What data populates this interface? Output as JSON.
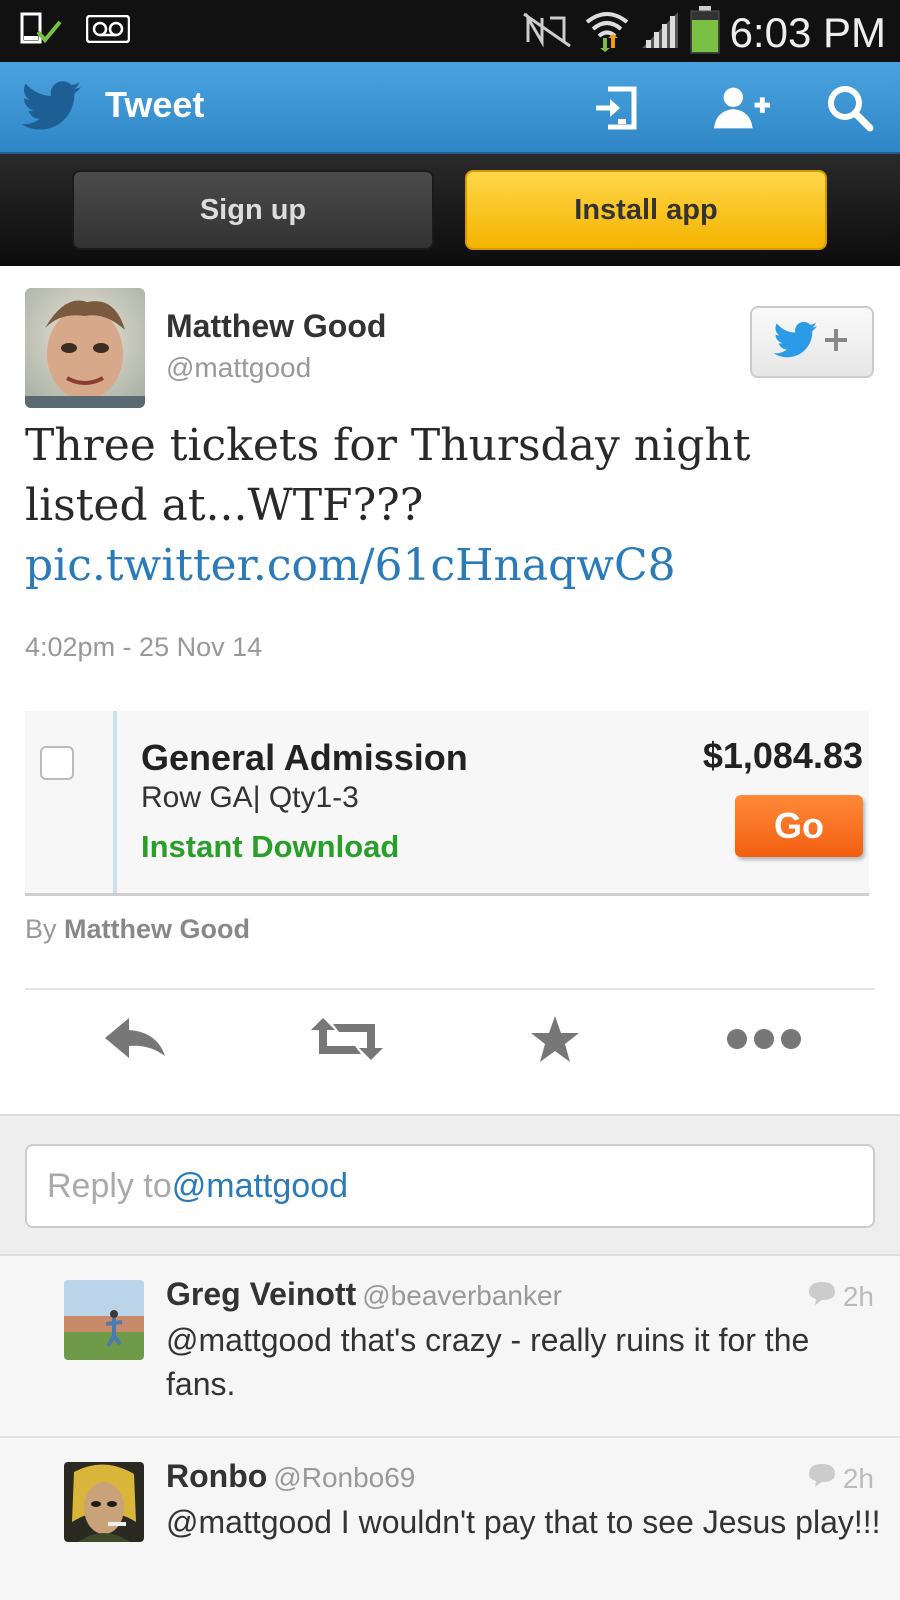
{
  "status_bar": {
    "time": "6:03 PM",
    "battery_color": "#7ac143"
  },
  "header": {
    "title": "Tweet",
    "bg_color": "#3a93d3"
  },
  "cta": {
    "signup_label": "Sign up",
    "install_label": "Install app"
  },
  "tweet": {
    "author_name": "Matthew Good",
    "author_handle": "@mattgood",
    "text": "Three tickets for Thursday night listed at...WTF???",
    "link": "pic.twitter.com/61cHnaqwC8",
    "timestamp": "4:02pm - 25 Nov 14",
    "by_prefix": "By",
    "by_name": "Matthew Good"
  },
  "embed": {
    "title": "General Admission",
    "row": "Row GA| Qty1-3",
    "delivery": "Instant Download",
    "price": "$1,084.83",
    "go_label": "Go"
  },
  "actions": [
    "reply-icon",
    "retweet-icon",
    "star-icon",
    "more-icon"
  ],
  "reply_box": {
    "prefix": "Reply to",
    "mention": "@mattgood"
  },
  "replies": [
    {
      "name": "Greg Veinott",
      "handle": "@beaverbanker",
      "time": "2h",
      "text": "@mattgood that's crazy - really ruins it for the fans."
    },
    {
      "name": "Ronbo",
      "handle": "@Ronbo69",
      "time": "2h",
      "text": "@mattgood I wouldn't pay that to see Jesus play!!!"
    }
  ]
}
